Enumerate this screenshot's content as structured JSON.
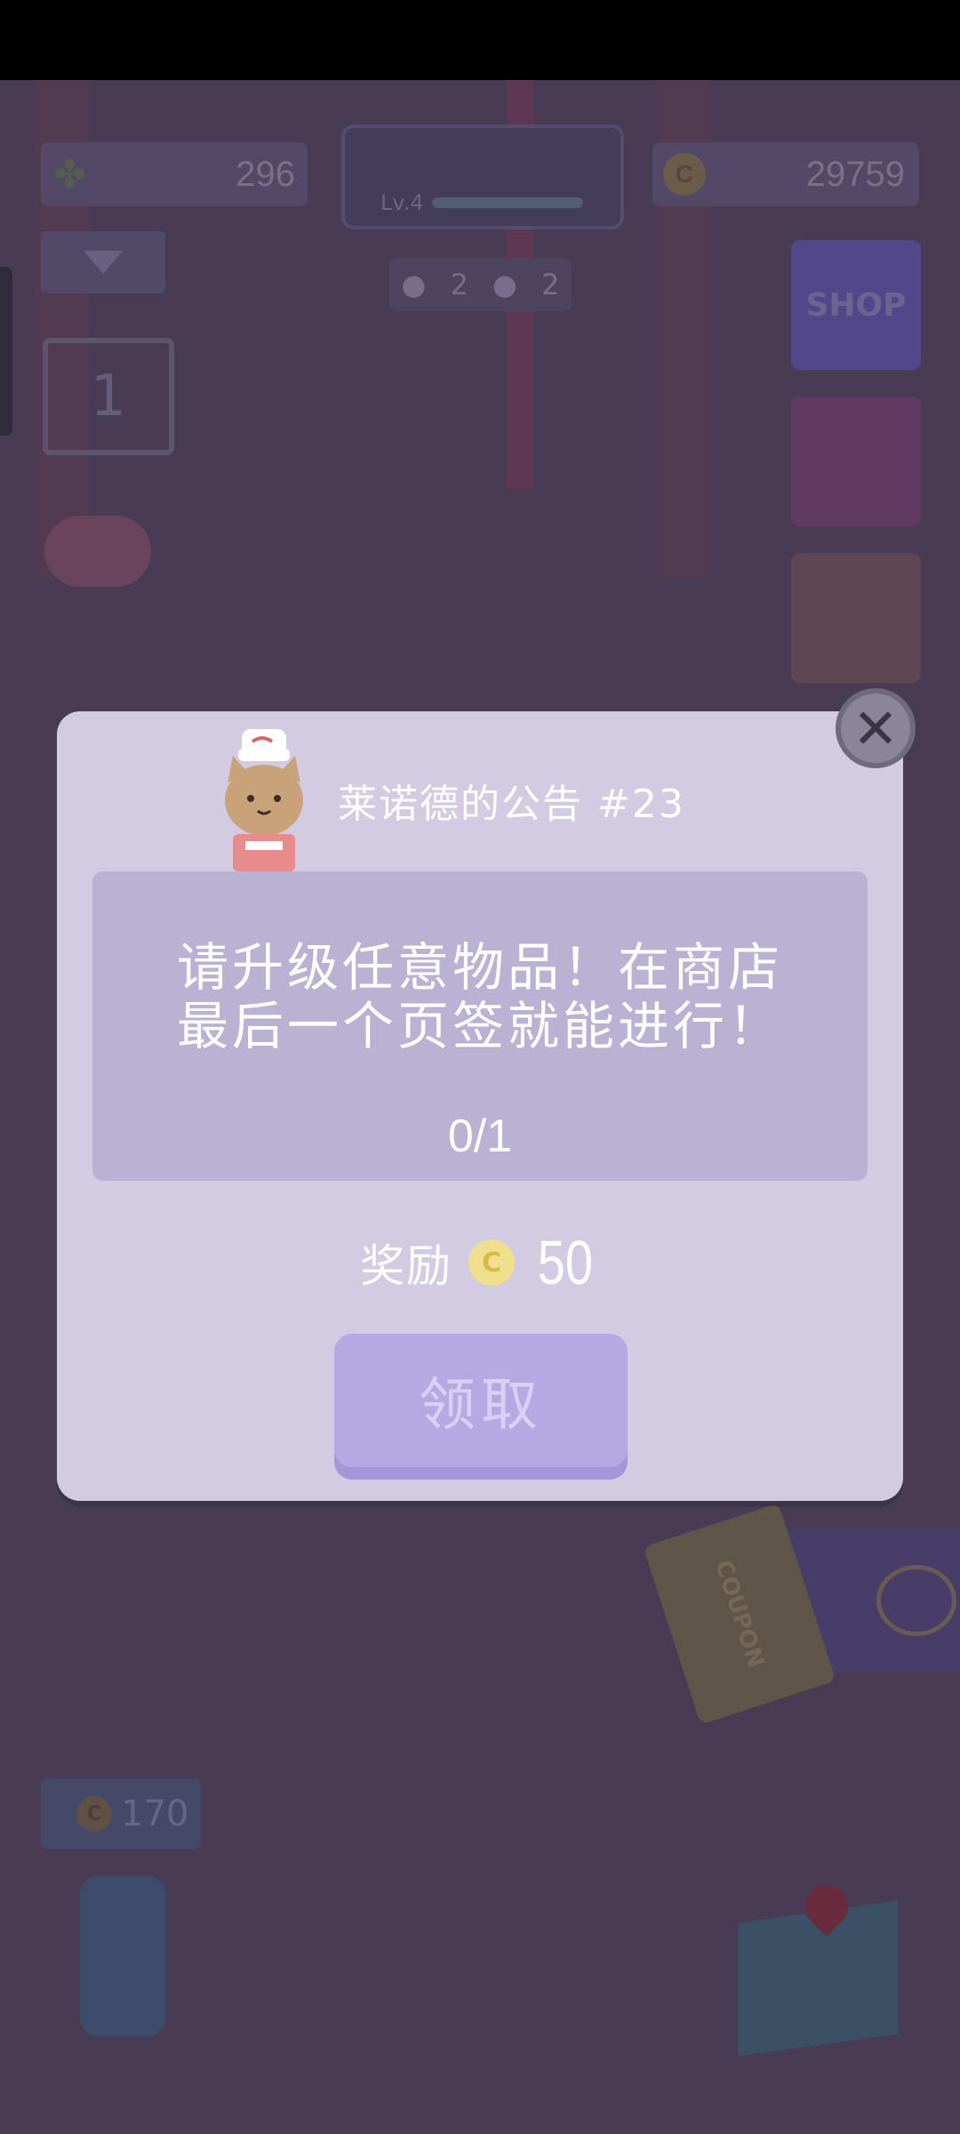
{
  "hud": {
    "clover_count": "296",
    "coin_total": "29759",
    "level_label": "Lv.4",
    "pet_dog_count": "2",
    "pet_cat_count": "2",
    "calendar_day": "1",
    "bubble_coin_value": "170",
    "coin_symbol": "C",
    "shop_label": "SHOP",
    "coupon_label": "COUPON"
  },
  "dialog": {
    "title": "莱诺德的公告 #23",
    "task_text": "请升级任意物品！在商店\n最后一个页签就能进行！",
    "progress": "0/1",
    "reward_label": "奖励",
    "reward_coin_symbol": "C",
    "reward_value": "50",
    "claim_label": "领取",
    "close_symbol": "✕"
  },
  "colors": {
    "dialog_bg": "#d3cbe1",
    "task_box": "#bab2d2",
    "claim_button": "#b6a8e2",
    "coin": "#f0e08e"
  }
}
